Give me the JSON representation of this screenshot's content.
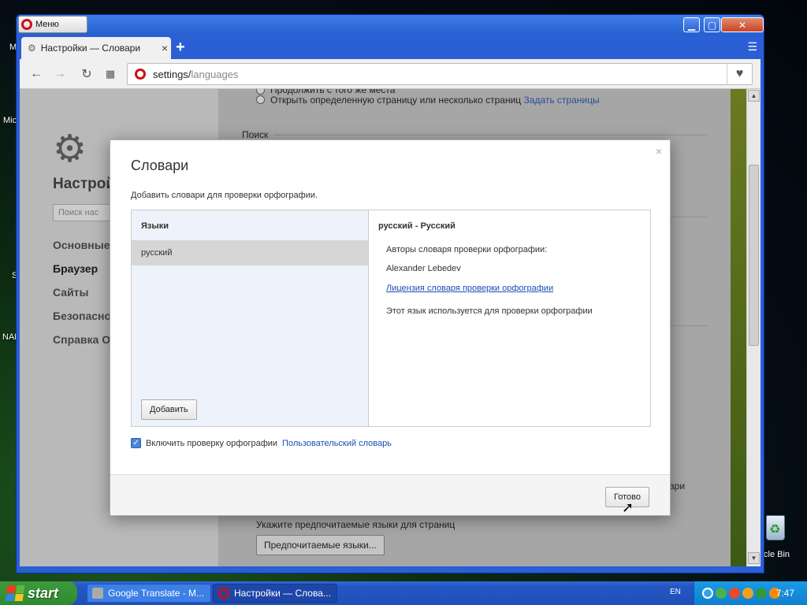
{
  "desktop": {
    "labels": [
      "M",
      "Mic",
      "S",
      "NAN"
    ],
    "recycle_label": "cycle Bin"
  },
  "window": {
    "menu_label": "Меню",
    "tab_title": "Настройки — Словари",
    "tab_close": "×",
    "new_tab": "+",
    "address": {
      "host": "settings/",
      "path": "languages"
    }
  },
  "settings": {
    "heading": "Настрой",
    "search_placeholder": "Поиск нас",
    "nav": [
      "Основные",
      "Браузер",
      "Сайты",
      "Безопасно",
      "Справка О"
    ],
    "startup_text": "Продолжить с того же места",
    "open_pages_text": "Открыть определенную страницу или несколько страниц",
    "open_pages_link": "Задать страницы",
    "search_heading": "Поиск",
    "partial_text": "ари",
    "pref_langs_text": "Укажите предпочитаемые языки для страниц",
    "pref_langs_button": "Предпочитаемые языки..."
  },
  "dialog": {
    "title": "Словари",
    "close": "×",
    "description": "Добавить словари для проверки орфографии.",
    "languages_header": "Языки",
    "language_item": "русский",
    "add_button": "Добавить",
    "selected_header": "русский - Русский",
    "authors_label": "Авторы словаря проверки орфографии:",
    "author": "Alexander Lebedev",
    "license_link": "Лицензия словаря проверки орфографии",
    "usage_text": "Этот язык используется для проверки орфографии",
    "enable_spellcheck": "Включить проверку орфографии",
    "enable_checked": true,
    "user_dictionary_link": "Пользовательский словарь",
    "done_button": "Готово"
  },
  "taskbar": {
    "start": "start",
    "tasks": [
      {
        "label": "Google Translate - M...",
        "active": false
      },
      {
        "label": "Настройки — Слова...",
        "active": true
      }
    ],
    "language": "EN",
    "clock": "7:47"
  },
  "colors": {
    "opera_red": "#cc0f16",
    "xp_blue": "#2a5fd6",
    "link_blue": "#1a4db3",
    "start_green": "#3c9a3c"
  }
}
